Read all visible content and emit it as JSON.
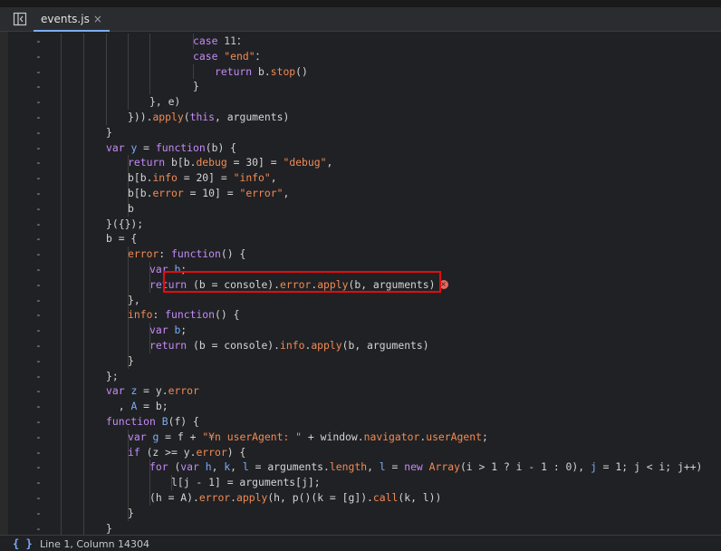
{
  "tab": {
    "filename": "events.js",
    "close_glyph": "×"
  },
  "status": {
    "braces": "{ }",
    "position": "Line 1, Column 14304"
  },
  "gutter_marker": "-",
  "lines": [
    {
      "indent": 5,
      "tokens": [
        [
          "kw",
          "case "
        ],
        [
          "num",
          "11"
        ],
        [
          "",
          "："
        ]
      ]
    },
    {
      "indent": 5,
      "tokens": [
        [
          "kw",
          "case "
        ],
        [
          "str",
          "\"end\""
        ],
        [
          "",
          "："
        ]
      ]
    },
    {
      "indent": 6,
      "tokens": [
        [
          "kw",
          "return "
        ],
        [
          "",
          "b."
        ],
        [
          "fn",
          "stop"
        ],
        [
          "",
          "()"
        ]
      ]
    },
    {
      "indent": 5,
      "tokens": [
        [
          "",
          "}"
        ]
      ]
    },
    {
      "indent": 3,
      "tokens": [
        [
          "",
          "}, e)"
        ]
      ]
    },
    {
      "indent": 2,
      "tokens": [
        [
          "",
          "}))."
        ],
        [
          "fn",
          "apply"
        ],
        [
          "",
          "("
        ],
        [
          "kw",
          "this"
        ],
        [
          "",
          ", arguments)"
        ]
      ]
    },
    {
      "indent": 1,
      "tokens": [
        [
          "",
          "}"
        ]
      ]
    },
    {
      "indent": 1,
      "tokens": [
        [
          "kw",
          "var "
        ],
        [
          "var",
          "y"
        ],
        [
          "",
          " = "
        ],
        [
          "kw",
          "function"
        ],
        [
          "",
          "(b) {"
        ]
      ]
    },
    {
      "indent": 2,
      "tokens": [
        [
          "kw",
          "return "
        ],
        [
          "",
          "b[b."
        ],
        [
          "prop",
          "debug"
        ],
        [
          "",
          " = 30] = "
        ],
        [
          "str",
          "\"debug\""
        ],
        [
          "",
          ","
        ]
      ]
    },
    {
      "indent": 2,
      "tokens": [
        [
          "",
          "b[b."
        ],
        [
          "prop",
          "info"
        ],
        [
          "",
          " = 20] = "
        ],
        [
          "str",
          "\"info\""
        ],
        [
          "",
          ","
        ]
      ]
    },
    {
      "indent": 2,
      "tokens": [
        [
          "",
          "b[b."
        ],
        [
          "prop",
          "error"
        ],
        [
          "",
          " = 10] = "
        ],
        [
          "str",
          "\"error\""
        ],
        [
          "",
          ","
        ]
      ]
    },
    {
      "indent": 2,
      "tokens": [
        [
          "",
          "b"
        ]
      ]
    },
    {
      "indent": 1,
      "tokens": [
        [
          "",
          "}({});"
        ]
      ]
    },
    {
      "indent": 1,
      "tokens": [
        [
          "",
          "b = {"
        ]
      ]
    },
    {
      "indent": 2,
      "tokens": [
        [
          "prop",
          "error"
        ],
        [
          "",
          ": "
        ],
        [
          "kw",
          "function"
        ],
        [
          "",
          "() {"
        ]
      ]
    },
    {
      "indent": 3,
      "tokens": [
        [
          "kw",
          "var "
        ],
        [
          "var",
          "b"
        ],
        [
          "",
          ";"
        ]
      ]
    },
    {
      "indent": 3,
      "tokens": [
        [
          "kw",
          "return "
        ],
        [
          "",
          "(b = console)."
        ],
        [
          "fn",
          "error"
        ],
        [
          "",
          "."
        ],
        [
          "fn",
          "apply"
        ],
        [
          "",
          "(b, arguments)"
        ]
      ],
      "error": true
    },
    {
      "indent": 2,
      "tokens": [
        [
          "",
          "},"
        ]
      ]
    },
    {
      "indent": 2,
      "tokens": [
        [
          "prop",
          "info"
        ],
        [
          "",
          ": "
        ],
        [
          "kw",
          "function"
        ],
        [
          "",
          "() {"
        ]
      ]
    },
    {
      "indent": 3,
      "tokens": [
        [
          "kw",
          "var "
        ],
        [
          "var",
          "b"
        ],
        [
          "",
          ";"
        ]
      ]
    },
    {
      "indent": 3,
      "tokens": [
        [
          "kw",
          "return "
        ],
        [
          "",
          "(b = console)."
        ],
        [
          "fn",
          "info"
        ],
        [
          "",
          "."
        ],
        [
          "fn",
          "apply"
        ],
        [
          "",
          "(b, arguments)"
        ]
      ]
    },
    {
      "indent": 2,
      "tokens": [
        [
          "",
          "}"
        ]
      ]
    },
    {
      "indent": 1,
      "tokens": [
        [
          "",
          "};"
        ]
      ]
    },
    {
      "indent": 1,
      "tokens": [
        [
          "kw",
          "var "
        ],
        [
          "var",
          "z"
        ],
        [
          "",
          " = y."
        ],
        [
          "prop",
          "error"
        ]
      ]
    },
    {
      "indent": 1,
      "tokens": [
        [
          "",
          "  , "
        ],
        [
          "var",
          "A"
        ],
        [
          "",
          " = b;"
        ]
      ]
    },
    {
      "indent": 1,
      "tokens": [
        [
          "kw",
          "function "
        ],
        [
          "var",
          "B"
        ],
        [
          "",
          "(f) {"
        ]
      ]
    },
    {
      "indent": 2,
      "tokens": [
        [
          "kw",
          "var "
        ],
        [
          "var",
          "g"
        ],
        [
          "",
          " = f + "
        ],
        [
          "str",
          "\"¥n userAgent: \""
        ],
        [
          "",
          " + window."
        ],
        [
          "prop",
          "navigator"
        ],
        [
          "",
          "."
        ],
        [
          "prop",
          "userAgent"
        ],
        [
          "",
          ";"
        ]
      ]
    },
    {
      "indent": 2,
      "tokens": [
        [
          "kw",
          "if "
        ],
        [
          "",
          "(z >= y."
        ],
        [
          "prop",
          "error"
        ],
        [
          "",
          ") {"
        ]
      ]
    },
    {
      "indent": 3,
      "tokens": [
        [
          "kw",
          "for "
        ],
        [
          "",
          "("
        ],
        [
          "kw",
          "var "
        ],
        [
          "var",
          "h"
        ],
        [
          "",
          ", "
        ],
        [
          "var",
          "k"
        ],
        [
          "",
          ", "
        ],
        [
          "var",
          "l"
        ],
        [
          "",
          " = arguments."
        ],
        [
          "prop",
          "length"
        ],
        [
          "",
          ", "
        ],
        [
          "var",
          "l"
        ],
        [
          "",
          " = "
        ],
        [
          "kw",
          "new "
        ],
        [
          "fn",
          "Array"
        ],
        [
          "",
          "(i > 1 ? i - 1 : 0), "
        ],
        [
          "var",
          "j"
        ],
        [
          "",
          " = 1; j < i; j++)"
        ]
      ]
    },
    {
      "indent": 4,
      "tokens": [
        [
          "",
          "l[j - 1] = arguments[j];"
        ]
      ]
    },
    {
      "indent": 3,
      "tokens": [
        [
          "",
          "(h = A)."
        ],
        [
          "fn",
          "error"
        ],
        [
          "",
          "."
        ],
        [
          "fn",
          "apply"
        ],
        [
          "",
          "(h, p()(k = [g])."
        ],
        [
          "fn",
          "call"
        ],
        [
          "",
          "(k, l))"
        ]
      ]
    },
    {
      "indent": 2,
      "tokens": [
        [
          "",
          "}"
        ]
      ]
    },
    {
      "indent": 1,
      "tokens": [
        [
          "",
          "}"
        ]
      ]
    }
  ]
}
